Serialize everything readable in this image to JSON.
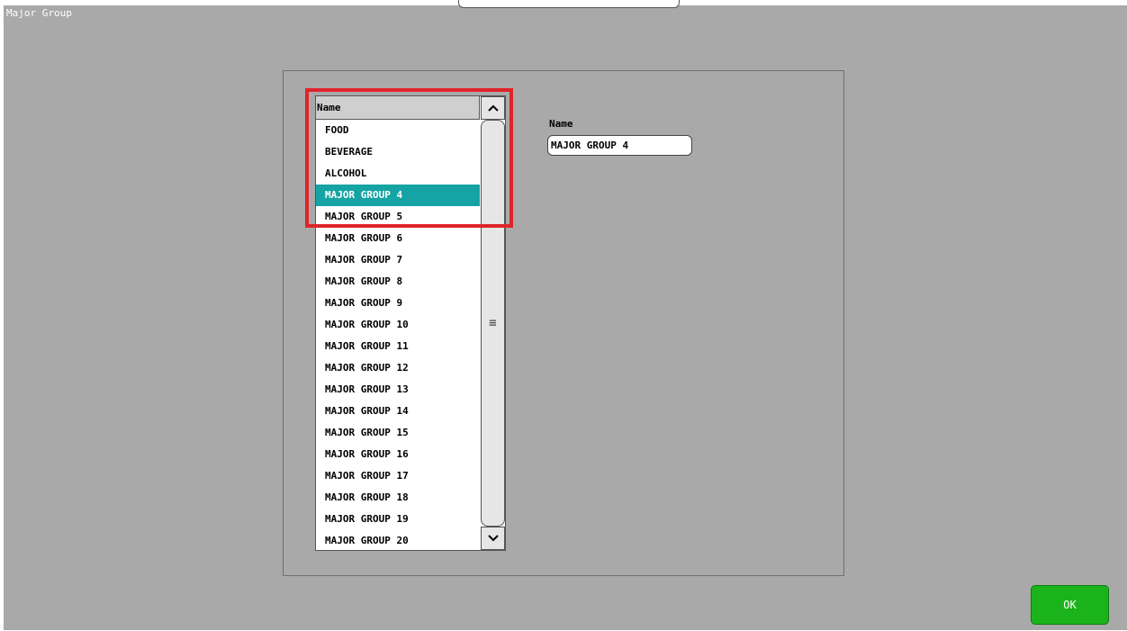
{
  "window": {
    "title": "Major Group"
  },
  "list": {
    "header": "Name",
    "items": [
      "FOOD",
      "BEVERAGE",
      "ALCOHOL",
      "MAJOR GROUP 4",
      "MAJOR GROUP 5",
      "MAJOR GROUP 6",
      "MAJOR GROUP 7",
      "MAJOR GROUP 8",
      "MAJOR GROUP 9",
      "MAJOR GROUP 10",
      "MAJOR GROUP 11",
      "MAJOR GROUP 12",
      "MAJOR GROUP 13",
      "MAJOR GROUP 14",
      "MAJOR GROUP 15",
      "MAJOR GROUP 16",
      "MAJOR GROUP 17",
      "MAJOR GROUP 18",
      "MAJOR GROUP 19",
      "MAJOR GROUP 20"
    ],
    "selected_index": 3,
    "scroll_up_icon": "chevron-up-icon",
    "scroll_down_icon": "chevron-down-icon",
    "thumb_grip": "≡"
  },
  "detail": {
    "name_label": "Name",
    "name_value": "MAJOR GROUP 4"
  },
  "actions": {
    "ok_label": "OK"
  },
  "colors": {
    "background": "#a9a9a9",
    "selection": "#15a3a3",
    "highlight": "#e0242a",
    "ok": "#1bb31b"
  }
}
